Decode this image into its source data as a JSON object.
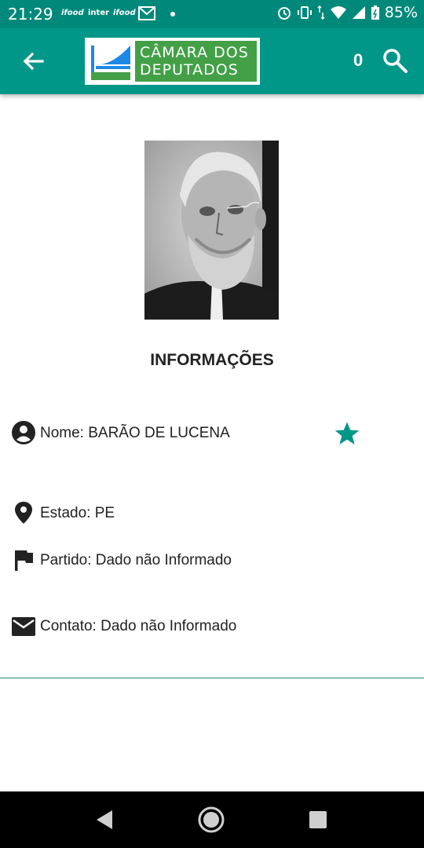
{
  "status_bar": {
    "time": "21:29",
    "notif_1": "ifood",
    "notif_2": "inter",
    "notif_3": "ifood",
    "battery": "85%"
  },
  "app_bar": {
    "logo_line1": "CÂMARA DOS",
    "logo_line2": "DEPUTADOS",
    "favorites_count": "0"
  },
  "profile": {
    "section_title": "INFORMAÇÕES",
    "name": "Nome: BARÃO DE LUCENA",
    "state": "Estado: PE",
    "party": "Partido: Dado não Informado",
    "contact": "Contato: Dado não Informado"
  },
  "colors": {
    "primary": "#009688",
    "status_bar": "#00897b",
    "logo_green": "#43a047",
    "accent": "#009688"
  },
  "icons": [
    "back-arrow-icon",
    "search-icon",
    "person-icon",
    "star-icon",
    "location-pin-icon",
    "flag-icon",
    "mail-icon",
    "nav-back-icon",
    "nav-home-icon",
    "nav-recents-icon"
  ]
}
